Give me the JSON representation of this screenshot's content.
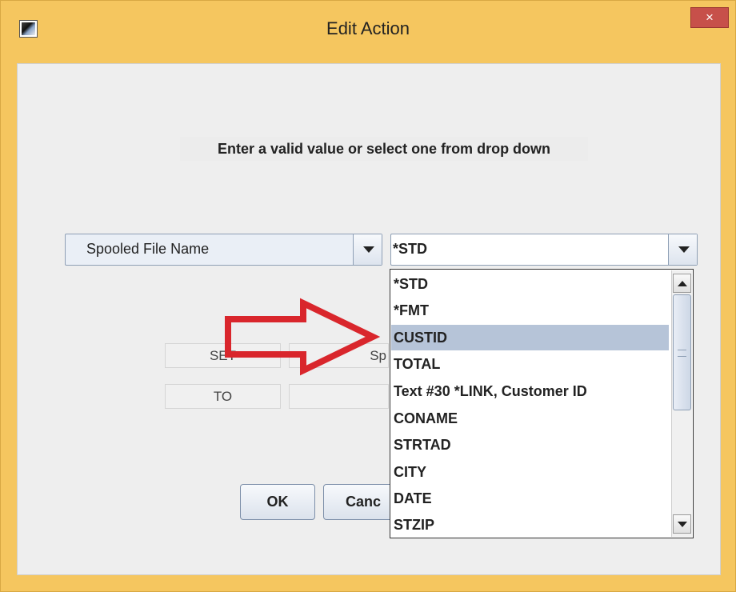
{
  "window": {
    "title": "Edit Action",
    "close_label": "×"
  },
  "instruction": "Enter a valid value or select one from drop down",
  "field_combo": {
    "selected": "Spooled File Name"
  },
  "value_combo": {
    "selected": "*STD",
    "options": [
      "*STD",
      "*FMT",
      "CUSTID",
      "TOTAL",
      "Text #30 *LINK, Customer ID",
      "CONAME",
      "STRTAD",
      "CITY",
      "DATE",
      "STZIP"
    ],
    "highlighted": "CUSTID"
  },
  "background_fields": {
    "set_label": "SET",
    "to_label": "TO",
    "spooled_partial": "Sp"
  },
  "buttons": {
    "ok": "OK",
    "cancel_partial": "Canc"
  },
  "colors": {
    "title_bar": "#f5c65f",
    "close_button": "#c7504a",
    "selection": "#b6c4d8",
    "annotation_arrow": "#d9262c"
  }
}
